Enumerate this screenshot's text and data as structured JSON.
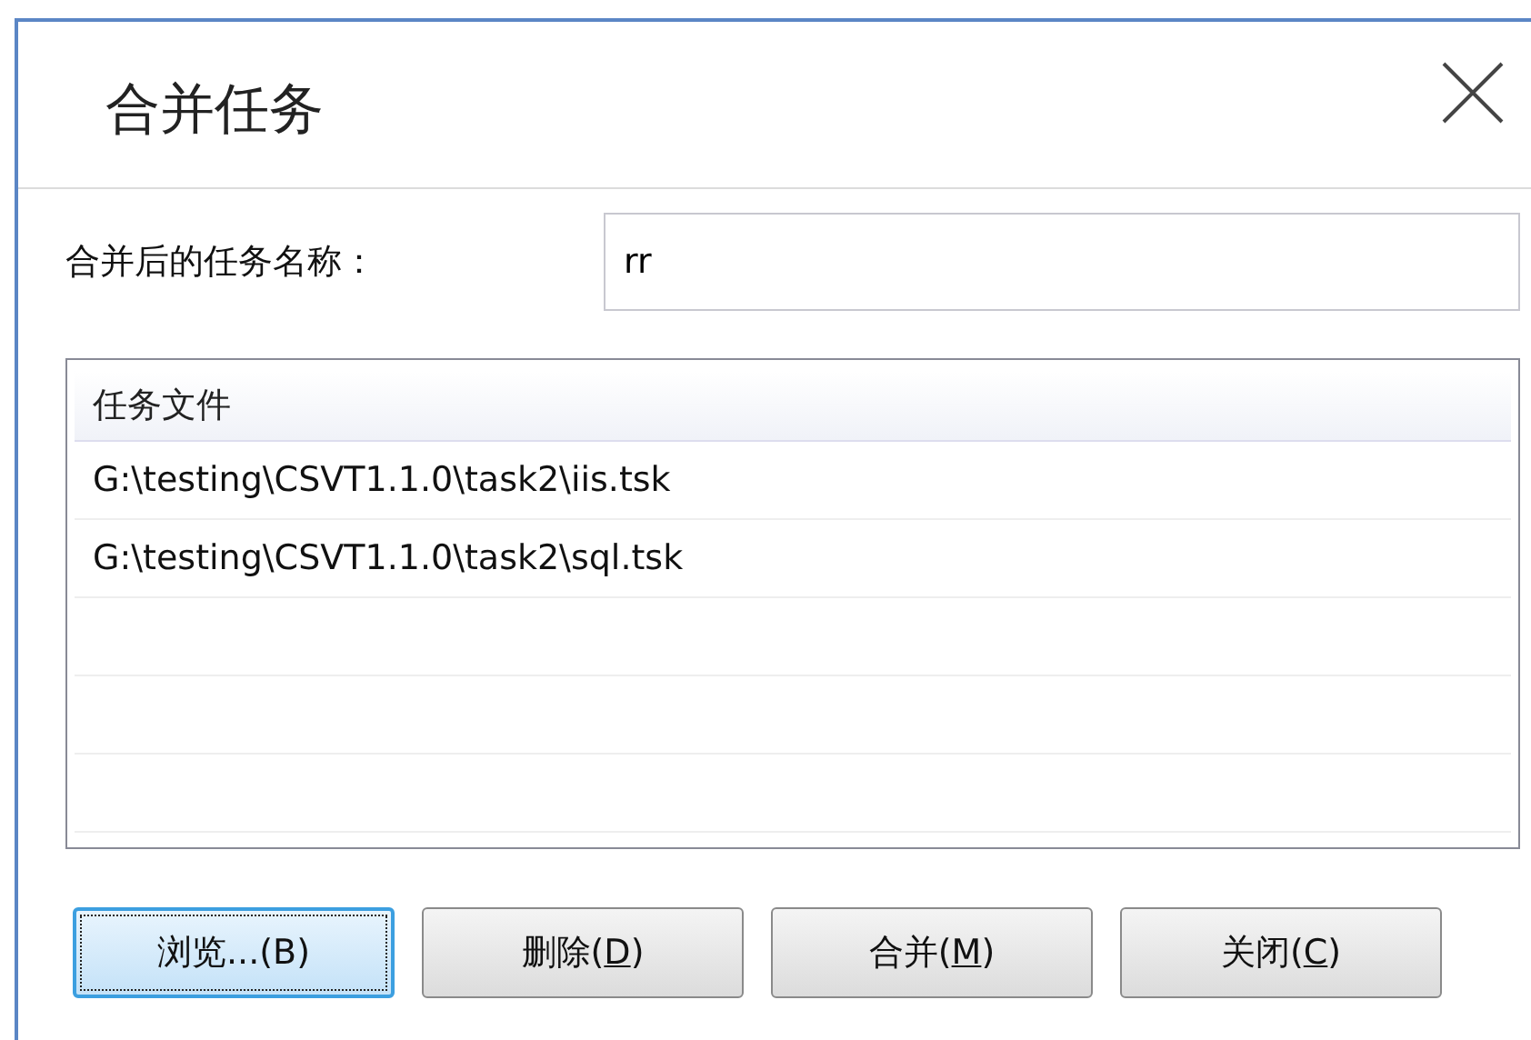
{
  "window": {
    "title": "合并任务"
  },
  "name_field": {
    "label": "合并后的任务名称：",
    "value": "rr"
  },
  "file_list": {
    "columns": [
      "任务文件"
    ],
    "rows": [
      "G:\\testing\\CSVT1.1.0\\task2\\iis.tsk",
      "G:\\testing\\CSVT1.1.0\\task2\\sql.tsk"
    ]
  },
  "buttons": [
    {
      "before": "浏览...(B)",
      "focused": true
    },
    {
      "before": "删除(",
      "key": "D",
      "after": ")",
      "focused": false
    },
    {
      "before": "合并(",
      "key": "M",
      "after": ")",
      "focused": false
    },
    {
      "before": "关闭(",
      "key": "C",
      "after": ")",
      "focused": false
    }
  ]
}
